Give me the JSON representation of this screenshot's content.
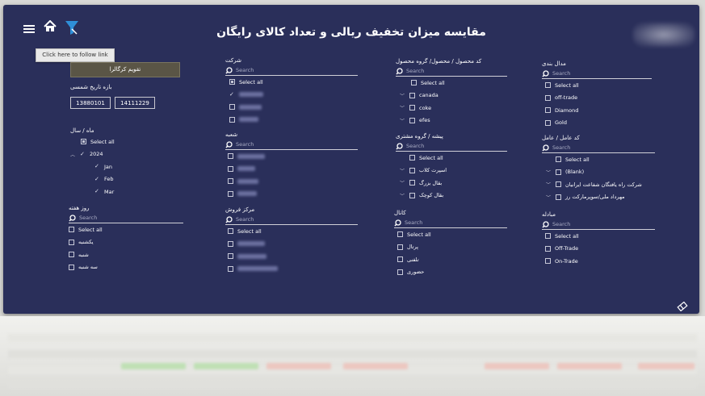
{
  "header": {
    "title": "مقایسه میزان تخفیف ریالی و تعداد کالای رایگان",
    "tooltip": "Click here to follow link"
  },
  "calendar_button": "تقویم کرگالرا",
  "date_range": {
    "label": "بازه تاریخ شمسی",
    "start": "13880101",
    "end": "14111229"
  },
  "slicers": {
    "month_year": {
      "label": "ماه / سال",
      "items": [
        "Select all",
        "2024",
        "Jan",
        "Feb",
        "Mar"
      ]
    },
    "weekday": {
      "label": "روز هفته",
      "search": "Search",
      "items": [
        "Select all",
        "یکشنبه",
        "شنبه",
        "سه شنبه"
      ]
    },
    "company": {
      "label": "شرکت",
      "search": "Search",
      "items": [
        "Select all"
      ]
    },
    "branch": {
      "label": "شعبه",
      "search": "Search"
    },
    "sales_center": {
      "label": "مرکز فروش",
      "search": "Search",
      "items": [
        "Select all"
      ]
    },
    "product_code": {
      "label": "کد محصول / محصول/ گروه محصول",
      "search": "Search",
      "items": [
        "Select all",
        "canada",
        "coke",
        "efes"
      ]
    },
    "profession": {
      "label": "پیشه / گروه مشتری",
      "search": "Search",
      "items": [
        "Select all",
        "اسپرت کلاب",
        "بقال بزرگ",
        "بقال کوچک"
      ]
    },
    "channel": {
      "label": "کانال",
      "search": "Search",
      "items": [
        "Select all",
        "پرتال",
        "تلفنی",
        "حضوری"
      ]
    },
    "channel_type": {
      "label": "مدال بندی",
      "search": "Search",
      "items": [
        "Select all",
        "off-trade",
        "Diamond",
        "Gold"
      ]
    },
    "agent": {
      "label": "کد عامل / عامل",
      "search": "Search",
      "items": [
        "Select all",
        "(Blank)",
        "شرکت راه یافتگان شفاعت ایرانیان",
        "مهرداد ملی/سوپرمارکت رز"
      ]
    },
    "exchange": {
      "label": "مبادله",
      "search": "Search",
      "items": [
        "Select all",
        "Off-Trade",
        "On-Trade"
      ]
    }
  },
  "icons": {
    "menu": "hamburger-icon",
    "home": "home-icon",
    "filter": "filter-icon",
    "eraser": "eraser-icon",
    "search": "search-icon"
  },
  "colors": {
    "background": "#2a2f5a",
    "accent": "#2f8fd8",
    "button": "#5a5546"
  }
}
